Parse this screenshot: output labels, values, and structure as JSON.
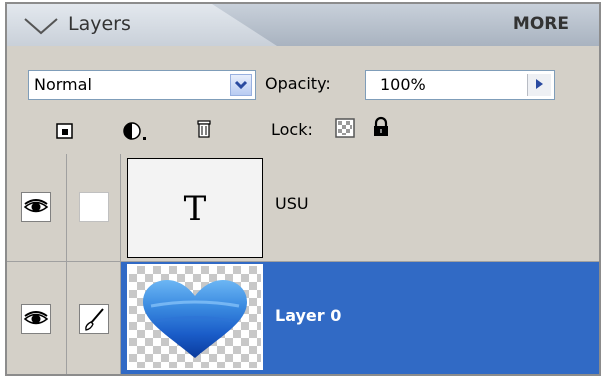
{
  "panel": {
    "title": "Layers",
    "more_label": "MORE"
  },
  "controls": {
    "blend_mode": "Normal",
    "opacity_label": "Opacity:",
    "opacity_value": "100%",
    "lock_label": "Lock:"
  },
  "icons": {
    "new_layer": "new-layer-icon",
    "adjustment": "adjustment-layer-icon",
    "delete": "trash-icon",
    "lock_transparent": "lock-transparency-icon",
    "lock_all": "padlock-icon",
    "visibility": "eye-icon",
    "brush": "brush-icon"
  },
  "layers": [
    {
      "name": "USU",
      "thumbnail": "T",
      "type": "text",
      "selected": false
    },
    {
      "name": "Layer 0",
      "type": "image",
      "selected": true
    }
  ],
  "colors": {
    "selection": "#316ac5",
    "panel_bg": "#d4d0c8",
    "heart_light": "#5aa8f0",
    "heart_dark": "#0a3a9c"
  }
}
